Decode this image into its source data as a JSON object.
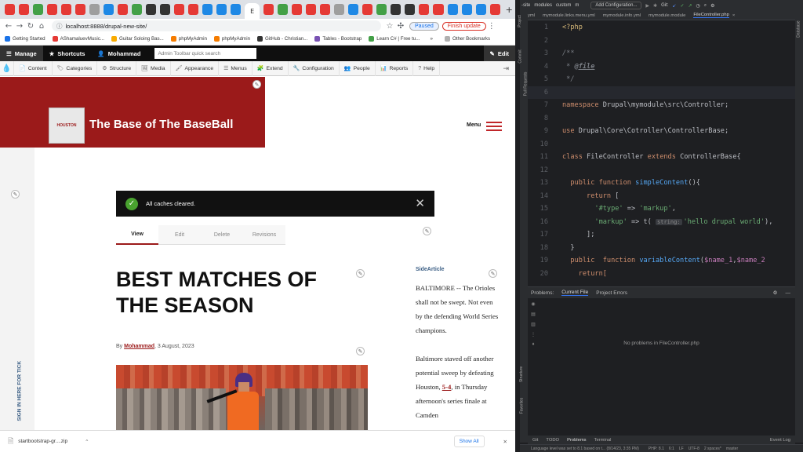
{
  "browser": {
    "tab_count": 35,
    "active_tab_label": "E",
    "url": "localhost:8888/drupal-new-site/",
    "paused_label": "Paused",
    "finish_update_label": "Finish update",
    "bookmarks": [
      "Getting Started",
      "AShamaluevMusic...",
      "Guitar Soloing Bas...",
      "phpMyAdmin",
      "phpMyAdmin",
      "GitHub - Christian...",
      "Tables - Bootstrap",
      "Learn C# | Free tu..."
    ],
    "other_bookmarks_label": "Other Bookmarks",
    "bookmarks_overflow": "»"
  },
  "toolbar": {
    "manage": "Manage",
    "shortcuts": "Shortcuts",
    "user": "Mohammad",
    "search_placeholder": "Admin Toolbar quick search",
    "edit": "Edit"
  },
  "admin_menu": [
    "Content",
    "Categories",
    "Structure",
    "Media",
    "Appearance",
    "Menus",
    "Extend",
    "Configuration",
    "People",
    "Reports",
    "Help"
  ],
  "site": {
    "name": "The Base of The BaseBall",
    "logo_text": "HOUSTON",
    "menu_label": "Menu",
    "signin_label": "SIGN IN HERE FOR TICK"
  },
  "status_message": "All caches cleared.",
  "local_tabs": [
    "View",
    "Edit",
    "Delete",
    "Revisions"
  ],
  "article": {
    "title": "BEST MATCHES OF THE SEASON",
    "by": "By",
    "author": "Mohammad",
    "date": ", 3 August, 2023"
  },
  "aside": {
    "title": "SideArticle",
    "p1": "BALTIMORE -- The Orioles shall not be swept. Not even by the defending World Series champions.",
    "p2_a": "Baltimore staved off another potential sweep by defeating Houston, ",
    "p2_link": "5-4",
    "p2_b": ", in Thursday afternoon's series finale at Camden"
  },
  "download": {
    "file": "startbootstrap-gr....zip",
    "show_all": "Show All"
  },
  "ide": {
    "top_items": [
      "-site",
      "modules",
      "custom",
      "m"
    ],
    "add_config": "Add Configuration...",
    "git_label": "Git:",
    "file_tabs": [
      "yml",
      "mymodule.links.menu.yml",
      "mymodule.info.yml",
      "mymodule.module",
      "FileController.php"
    ],
    "code_lines": [
      {
        "n": "1"
      },
      {
        "n": "2"
      },
      {
        "n": "3"
      },
      {
        "n": "4"
      },
      {
        "n": "5"
      },
      {
        "n": "6"
      },
      {
        "n": "7"
      },
      {
        "n": "8"
      },
      {
        "n": "9"
      },
      {
        "n": "10"
      },
      {
        "n": "11"
      },
      {
        "n": "12"
      },
      {
        "n": "13"
      },
      {
        "n": "14"
      },
      {
        "n": "15"
      },
      {
        "n": "16"
      },
      {
        "n": "17"
      },
      {
        "n": "18"
      },
      {
        "n": "19"
      },
      {
        "n": "20"
      }
    ],
    "code": {
      "l1": "<?php",
      "l3": "/**",
      "l4_a": " * ",
      "l4_b": "@file",
      "l5": " */",
      "l7_kw": "namespace",
      "l7_rest": " Drupal\\mymodule\\src\\Controller;",
      "l9_kw": "use",
      "l9_rest": " Drupal\\Core\\Cotroller\\ControllerBase;",
      "l11_kw1": "class",
      "l11_a": " FileController ",
      "l11_kw2": "extends",
      "l11_b": " ControllerBase{",
      "l13_kw": "  public function ",
      "l13_fn": "simpleContent",
      "l13_rest": "(){",
      "l14_kw": "      return",
      "l14_rest": " [",
      "l15_st1": "        '#type'",
      "l15_op": " => ",
      "l15_st2": "'markup'",
      "l15_end": ",",
      "l16_st1": "        'markup'",
      "l16_op": " => t( ",
      "l16_hint": "string:",
      "l16_st2": "'hello drupal world'",
      "l16_end": "),",
      "l17": "      ];",
      "l18": "  }",
      "l19_kw": "  public  function ",
      "l19_fn": "variableContent",
      "l19_a": "(",
      "l19_v1": "$name_1",
      "l19_b": ",",
      "l19_v2": "$name_2",
      "l20": "    return["
    },
    "problems_label": "Problems:",
    "current_file": "Current File",
    "project_errors": "Project Errors",
    "no_problems": "No problems in FileController.php",
    "bottom_tools": [
      "Git",
      "TODO",
      "Problems",
      "Terminal"
    ],
    "event_log": "Event Log",
    "status_text": "Language level was set to 8.1 based on t... (8/14/23, 3:35 PM)",
    "status_right": [
      "PHP: 8.1",
      "6:1",
      "LF",
      "UTF-8",
      "2 spaces*",
      "master"
    ],
    "left_labels": [
      "Project",
      "Commit",
      "Pull Requests",
      "Structure",
      "Favorites"
    ],
    "right_label": "Database"
  }
}
